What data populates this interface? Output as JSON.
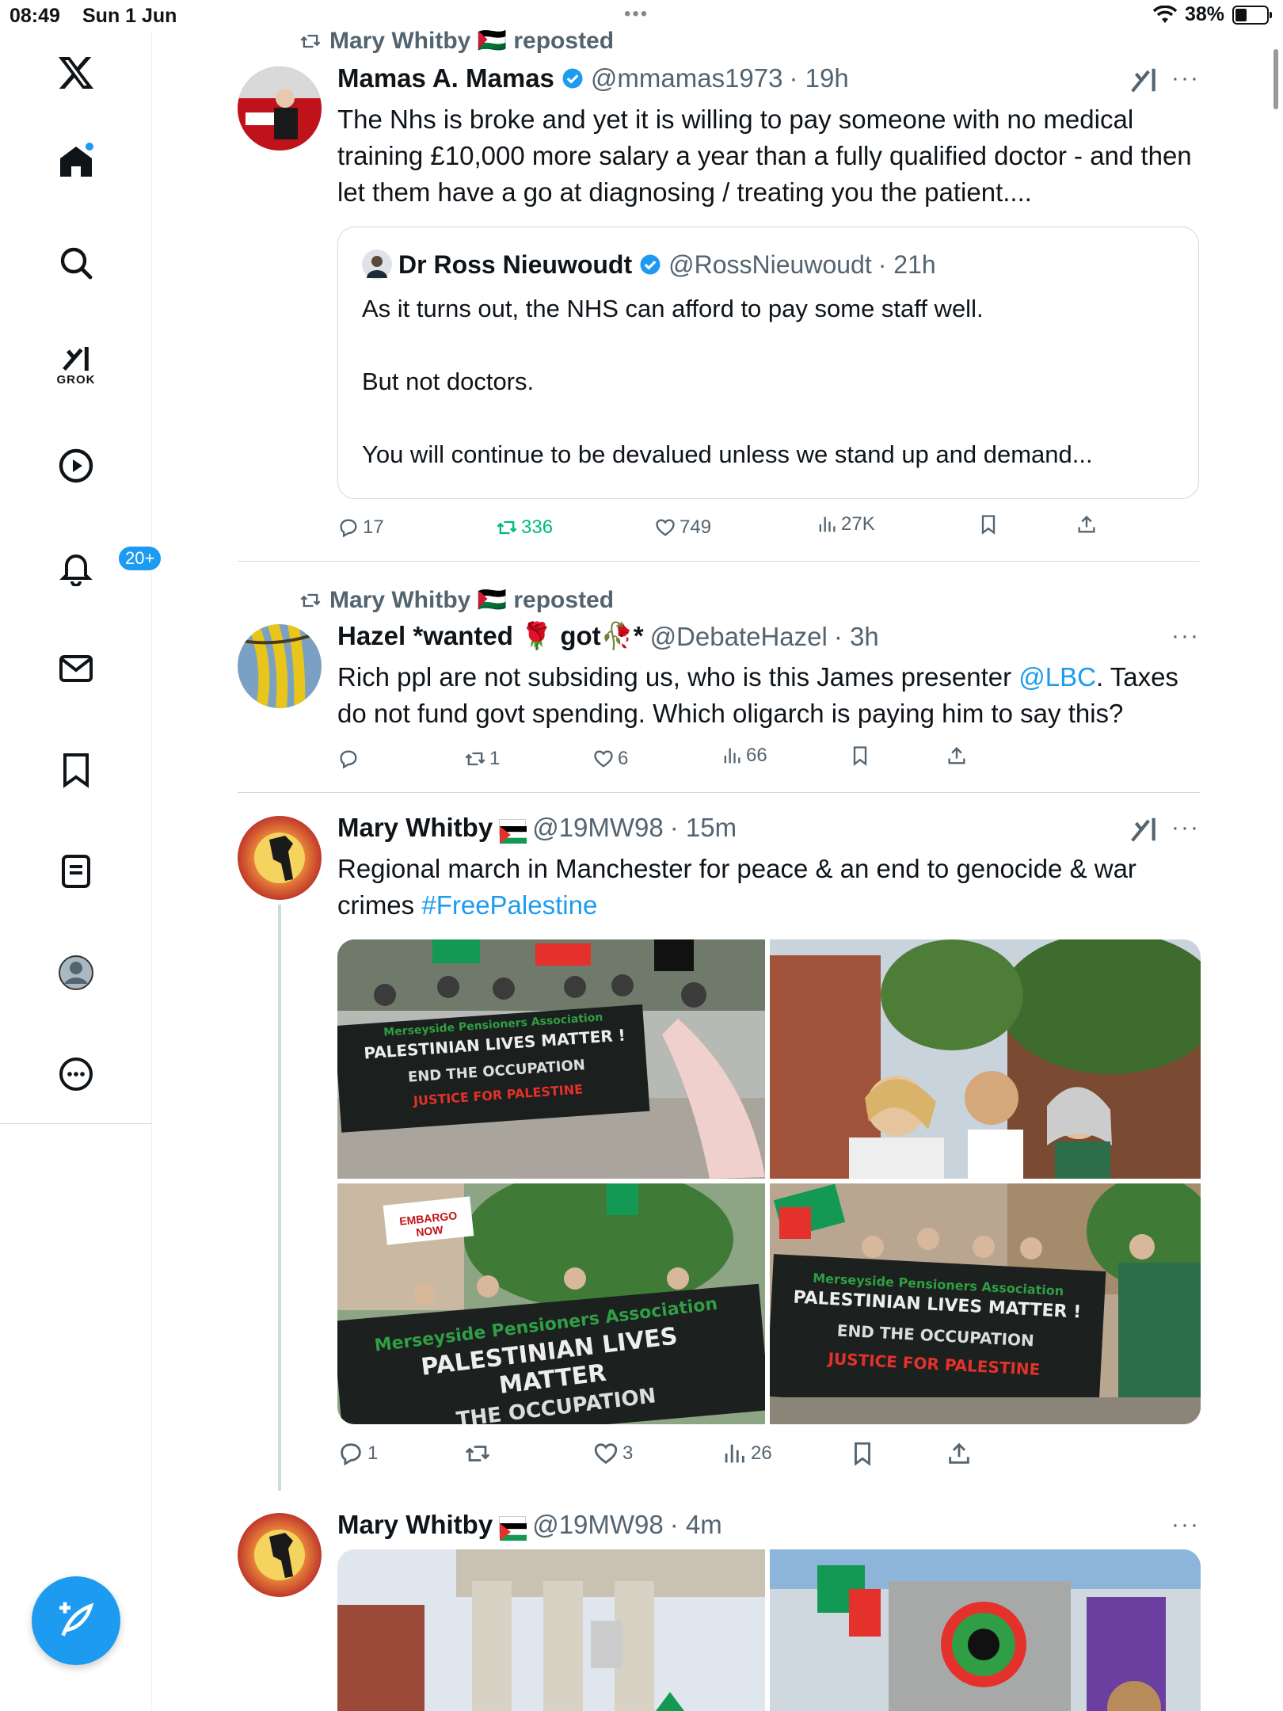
{
  "status": {
    "time": "08:49",
    "date": "Sun 1 Jun",
    "battery": "38%"
  },
  "sidebar": {
    "notifications_badge": "20+",
    "grok_label": "GROK",
    "items": [
      "x-logo",
      "home",
      "search",
      "grok",
      "video",
      "notifications",
      "messages",
      "bookmarks",
      "lists",
      "profile",
      "more"
    ]
  },
  "tweets": [
    {
      "repost_by": "Mary Whitby 🇵🇸 reposted",
      "name": "Mamas A. Mamas",
      "handle": "@mmamas1973",
      "time": "· 19h",
      "text": "The Nhs is broke and yet it is willing to pay someone with no medical training £10,000 more salary a year than a fully qualified doctor - and then let them have a go at diagnosing / treating you the patient....",
      "quote": {
        "name": "Dr Ross Nieuwoudt",
        "handle": "@RossNieuwoudt",
        "time": "· 21h",
        "line1": "As it turns out, the NHS can afford to pay some staff well.",
        "line2": "But not doctors.",
        "line3": "You will continue to be devalued unless we stand up and demand..."
      },
      "replies": "17",
      "reposts": "336",
      "likes": "749",
      "views": "27K"
    },
    {
      "repost_by": "Mary Whitby 🇵🇸 reposted",
      "name": "Hazel *wanted 🌹 got🥀*",
      "handle": "@DebateHazel",
      "time": "· 3h",
      "text_pre": "Rich ppl are not subsiding us, who is this James presenter ",
      "mention": "@LBC",
      "text_post": ". Taxes do not fund govt spending.  Which oligarch is paying him to say this?",
      "replies": "",
      "reposts": "1",
      "likes": "6",
      "views": "66"
    },
    {
      "name": "Mary Whitby",
      "handle": "@19MW98",
      "time": "· 15m",
      "text_pre": "Regional march in Manchester for peace & an end to genocide & war crimes ",
      "hashtag": "#FreePalestine",
      "banner1_org": "Merseyside Pensioners Association",
      "banner1_l1": "PALESTINIAN LIVES MATTER !",
      "banner1_l2": "END THE OCCUPATION",
      "banner1_l3": "JUSTICE FOR PALESTINE",
      "banner3_org": "Merseyside Pensioners Association",
      "banner3_l1": "PALESTINIAN LIVES MATTER",
      "banner3_l2": "THE OCCUPATION",
      "sign3": "EMBARGO NOW",
      "replies": "1",
      "reposts": "",
      "likes": "3",
      "views": "26"
    },
    {
      "name": "Mary Whitby",
      "handle": "@19MW98",
      "time": "· 4m"
    }
  ]
}
